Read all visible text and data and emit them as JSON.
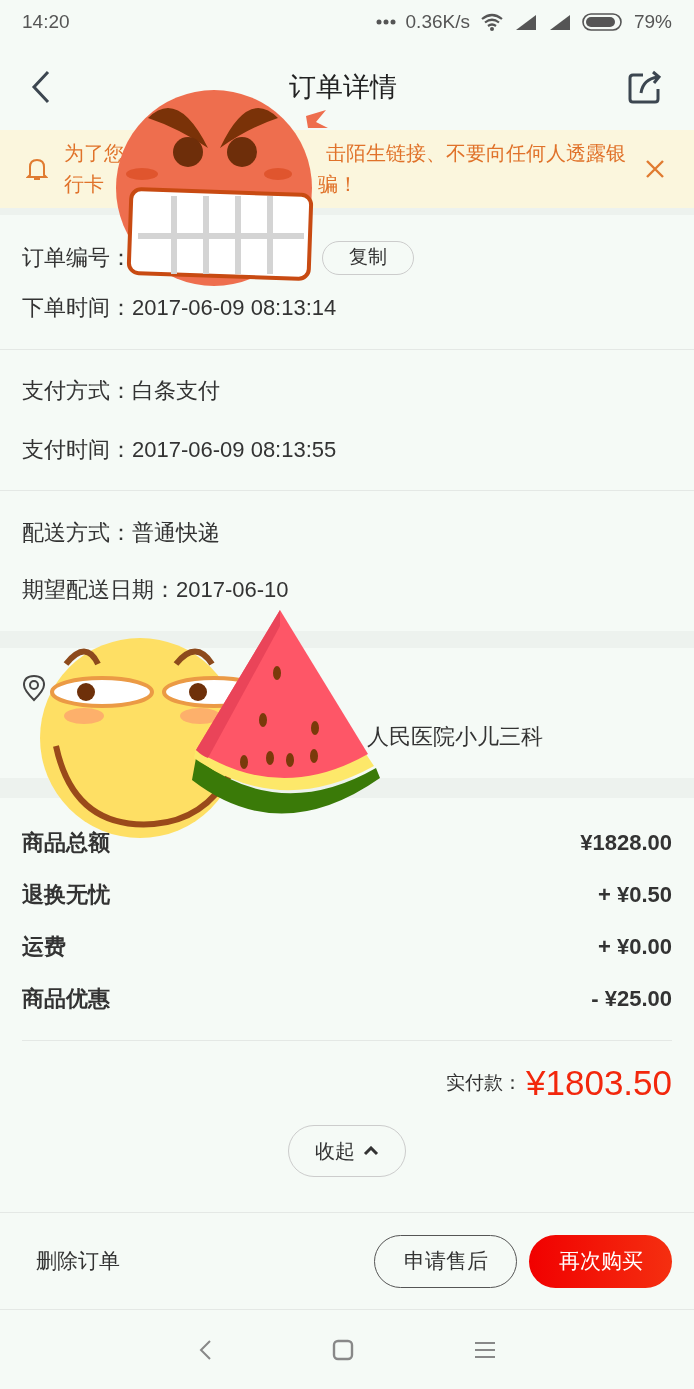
{
  "status_bar": {
    "time": "14:20",
    "network_speed": "0.36K/s",
    "battery": "79%"
  },
  "header": {
    "title": "订单详情"
  },
  "notice": {
    "lines": [
      [
        "为了您",
        "击陌生链接、不要向任何人透露银"
      ],
      [
        "行卡",
        "骗！"
      ]
    ]
  },
  "order_info": {
    "order_number_label": "订单编号：",
    "copy_button": "复制",
    "order_time": "下单时间：2017-06-09 08:13:14"
  },
  "payment": [
    "支付方式：白条支付",
    "支付时间：2017-06-09 08:13:55"
  ],
  "delivery": [
    "配送方式：普通快递",
    "期望配送日期：2017-06-10"
  ],
  "address": {
    "address_fragment": "人民医院小儿三科"
  },
  "totals": [
    {
      "label": "商品总额",
      "value": "¥1828.00"
    },
    {
      "label": "退换无忧",
      "value": "+ ¥0.50"
    },
    {
      "label": "运费",
      "value": "+ ¥0.00"
    },
    {
      "label": "商品优惠",
      "value": "- ¥25.00"
    }
  ],
  "paid": {
    "label": "实付款：",
    "amount": "¥1803.50"
  },
  "collapse_button": "收起",
  "actions": {
    "delete": "删除订单",
    "buttons": [
      {
        "label": "申请售后",
        "kind": "outline"
      },
      {
        "label": "再次购买",
        "kind": "primary"
      }
    ]
  }
}
